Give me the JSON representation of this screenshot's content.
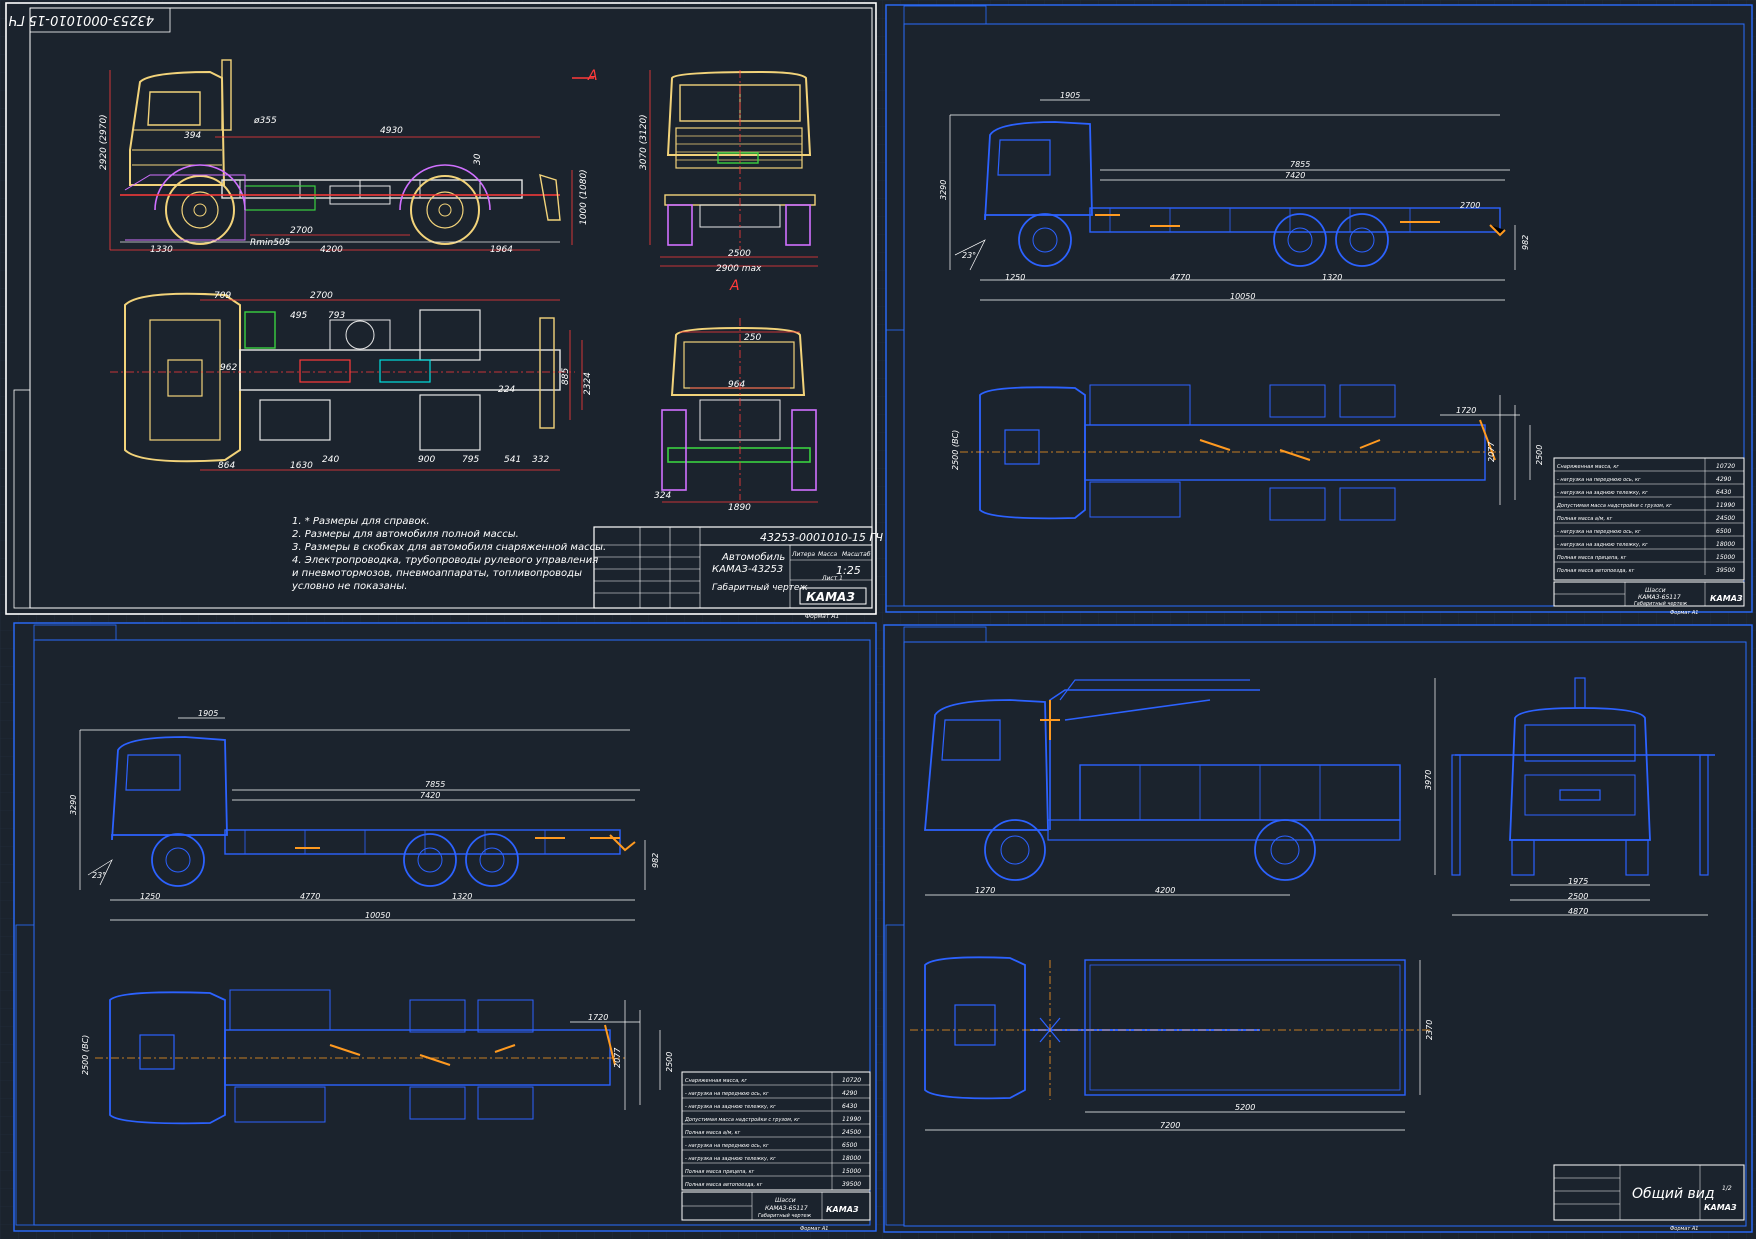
{
  "colors": {
    "background": "#1b232d",
    "sheet_border": "#ffffff",
    "frame": "#2a6cff",
    "cab_yellow": "#f2d37a",
    "chassis_white": "#e6e6e6",
    "dim_red": "#ff3a3a",
    "wheel_purple": "#d070ff",
    "component_green": "#3ad040",
    "blue_outline": "#2c62ff",
    "accent_orange": "#ff9a20",
    "grid": "#243040"
  },
  "sheet1": {
    "stamp_code": "43253-0001010-15 ГЧ",
    "section_mark": "А",
    "dims_side": [
      "2920 (2970)",
      "ø355",
      "394",
      "4930",
      "1330",
      "4200",
      "1964",
      "2700",
      "Rmin505",
      "1000 (1080)",
      "30"
    ],
    "dims_front": [
      "3070 (3120)",
      "2500",
      "2900 max"
    ],
    "dims_top": [
      "709",
      "2700",
      "495",
      "793",
      "962",
      "224",
      "885",
      "2324",
      "864",
      "1630",
      "240",
      "900",
      "795",
      "541",
      "332"
    ],
    "dims_rear": [
      "250",
      "964",
      "324",
      "1890"
    ],
    "notes": [
      "1. * Размеры для справок.",
      "2. Размеры для автомобиля полной массы.",
      "3. Размеры в скобках для автомобиля снаряженной массы.",
      "4. Электропроводка, трубопроводы рулевого управления",
      "   и пневмотормозов, пневмоаппараты, топливопроводы",
      "   условно не показаны."
    ],
    "title_block": {
      "doc_code": "43253-0001010-15 ГЧ",
      "name_line1": "Автомобиль",
      "name_line2": "КАМАЗ-43253",
      "name_line3": "Габаритный чертеж",
      "scale": "1:25",
      "logo": "КАМАЗ",
      "format": "Формат А1",
      "col_litera": "Литера",
      "col_mass": "Масса",
      "col_scale": "Масштаб",
      "sheet": "Лист 1"
    }
  },
  "sheet2": {
    "dims_side": [
      "1905",
      "3290",
      "7855",
      "7420",
      "1250",
      "4770",
      "1320",
      "10050",
      "2700",
      "982",
      "23°"
    ],
    "dims_top": [
      "2500 (ВС)",
      "1720",
      "2077",
      "2500"
    ],
    "spec_rows": [
      "Снаряженная масса, кг",
      "- нагрузка на переднюю ось, кг",
      "- нагрузка на заднюю тележку, кг",
      "Допустимая масса надстройки с грузом, кг",
      "Полная масса а/м, кг",
      "- нагрузка на переднюю ось, кг",
      "- нагрузка на заднюю тележку, кг",
      "Полная масса прицепа, кг",
      "Полная масса автопоезда, кг"
    ],
    "spec_values": [
      "10720",
      "4290",
      "6430",
      "11990",
      "24500",
      "6500",
      "18000",
      "15000",
      "39500"
    ],
    "title_block": {
      "name": "Шасси",
      "subname": "КАМАЗ-65117",
      "desc": "Габаритный чертеж",
      "logo": "КАМАЗ",
      "format": "Формат А1"
    }
  },
  "sheet3": {
    "dims_side": [
      "1905",
      "3290",
      "7855",
      "7420",
      "1250",
      "4770",
      "1320",
      "10050",
      "982",
      "23°"
    ],
    "dims_top": [
      "2500 (ВС)",
      "1720",
      "2077",
      "2500"
    ],
    "spec_rows": [
      "Снаряженная масса, кг",
      "- нагрузка на переднюю ось, кг",
      "- нагрузка на заднюю тележку, кг",
      "Допустимая масса надстройки с грузом, кг",
      "Полная масса а/м, кг",
      "- нагрузка на переднюю ось, кг",
      "- нагрузка на заднюю тележку, кг",
      "Полная масса прицепа, кг",
      "Полная масса автопоезда, кг"
    ],
    "spec_values": [
      "10720",
      "4290",
      "6430",
      "11990",
      "24500",
      "6500",
      "18000",
      "15000",
      "39500"
    ],
    "title_block": {
      "name": "Шасси",
      "subname": "КАМАЗ-65117",
      "desc": "Габаритный чертеж",
      "logo": "КАМАЗ",
      "format": "Формат А1"
    }
  },
  "sheet4": {
    "dims_side": [
      "1270",
      "4200"
    ],
    "dims_front": [
      "3970",
      "1975",
      "2500",
      "4870"
    ],
    "dims_top": [
      "5200",
      "7200",
      "2370"
    ],
    "title_block": {
      "name": "Общий вид",
      "logo": "КАМАЗ",
      "sheet_no": "1/2",
      "format": "Формат А1"
    }
  }
}
